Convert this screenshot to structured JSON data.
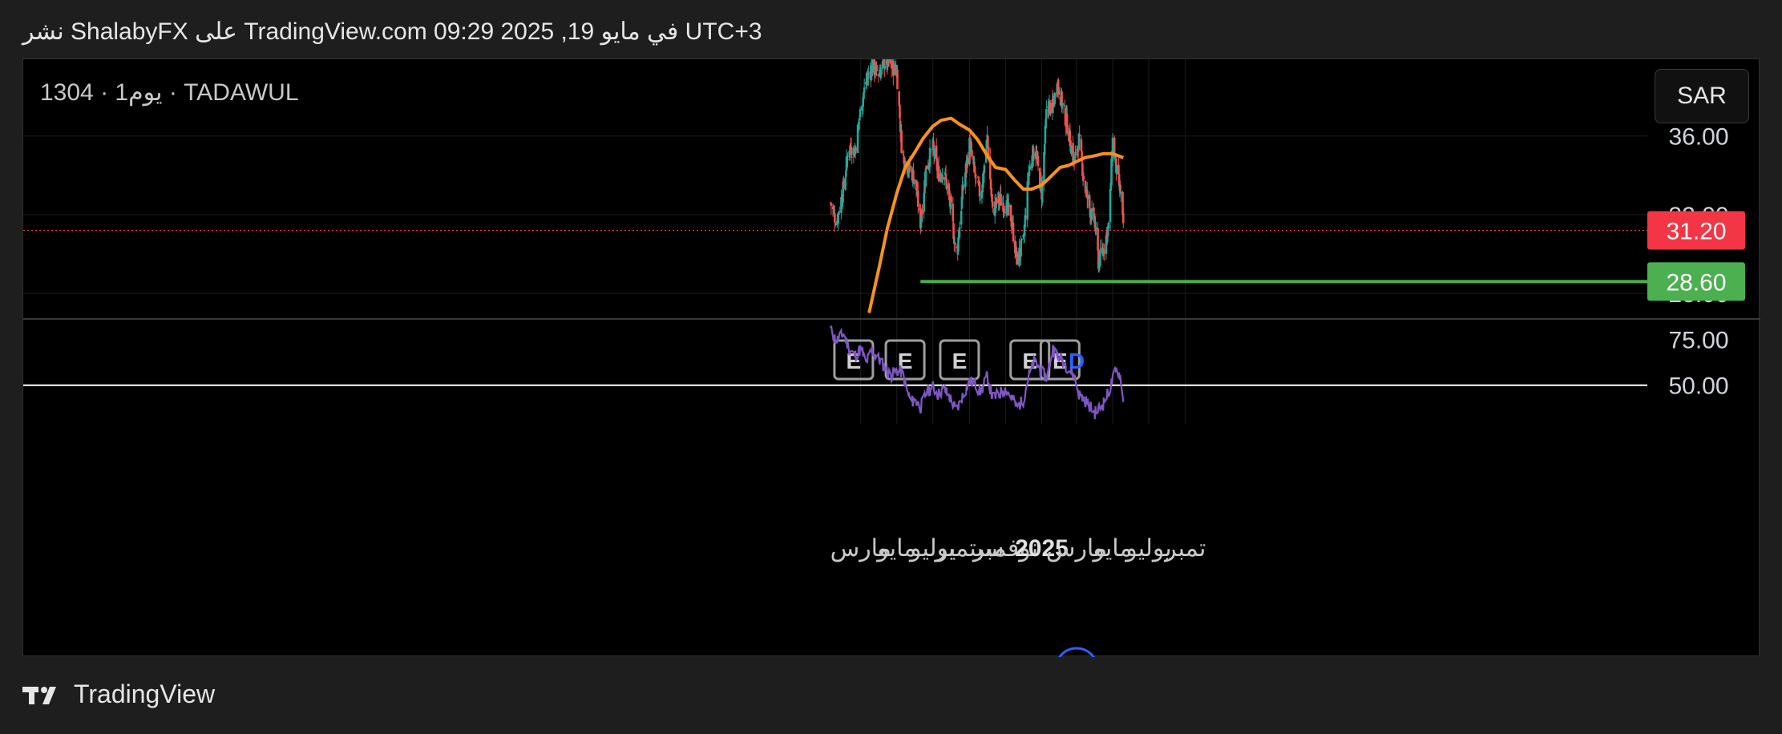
{
  "header": {
    "text": "نشر ShalabyFX على TradingView.com 09:29 2025 ,19 في مايو UTC+3"
  },
  "symbol": {
    "label": "1304 · 1يوم · TADAWUL"
  },
  "currency": {
    "label": "SAR"
  },
  "footer": {
    "brand": "TradingView",
    "logo_icon": "tradingview-logo-icon"
  },
  "colors": {
    "up": "#26a69a",
    "down": "#ef5350",
    "ma": "#f7931a",
    "support": "#4caf50",
    "rsi": "#7e57c2",
    "price_badge": "#f23645",
    "support_badge": "#4caf50"
  },
  "chart_data": [
    {
      "type": "candlestick",
      "title": "",
      "ylim": [
        26.7,
        39.9
      ],
      "y_ticks": [
        "36.00",
        "32.00",
        "28.00"
      ],
      "x_tick_labels": [
        "مارس",
        "مايو",
        "يوليو",
        "سبتمبر",
        "نوفمبر",
        "2025",
        "مارس",
        "مايو",
        "يوليو",
        "تمبر"
      ],
      "x_tick_dates": [
        "2024-03-01",
        "2024-05-01",
        "2024-07-01",
        "2024-09-01",
        "2024-11-01",
        "2025-01-01",
        "2025-03-01",
        "2025-05-01",
        "2025-07-01",
        "2025-09-01"
      ],
      "close_series": {
        "dates": [
          "2024-01-10",
          "2024-01-20",
          "2024-02-01",
          "2024-02-10",
          "2024-02-20",
          "2024-03-01",
          "2024-03-10",
          "2024-03-20",
          "2024-04-01",
          "2024-04-10",
          "2024-04-20",
          "2024-05-01",
          "2024-05-10",
          "2024-05-20",
          "2024-05-25",
          "2024-06-01",
          "2024-06-10",
          "2024-06-20",
          "2024-07-01",
          "2024-07-10",
          "2024-07-20",
          "2024-08-01",
          "2024-08-10",
          "2024-08-20",
          "2024-09-01",
          "2024-09-10",
          "2024-09-20",
          "2024-10-01",
          "2024-10-10",
          "2024-10-20",
          "2024-11-01",
          "2024-11-10",
          "2024-11-20",
          "2024-12-01",
          "2024-12-10",
          "2024-12-20",
          "2025-01-01",
          "2025-01-10",
          "2025-01-20",
          "2025-01-27",
          "2025-02-05",
          "2025-02-15",
          "2025-02-25",
          "2025-03-05",
          "2025-03-15",
          "2025-03-25",
          "2025-04-01",
          "2025-04-07",
          "2025-04-15",
          "2025-04-25",
          "2025-05-01",
          "2025-05-08",
          "2025-05-15",
          "2025-05-19"
        ],
        "close": [
          32.6,
          31.6,
          33.4,
          35.5,
          35.2,
          37.4,
          38.8,
          39.5,
          39.2,
          39.8,
          39.6,
          39.3,
          35.1,
          34.4,
          34.2,
          33.8,
          31.6,
          34.5,
          35.4,
          34.1,
          34.2,
          32.2,
          29.8,
          33.1,
          35.6,
          34.0,
          32.9,
          35.9,
          32.1,
          32.8,
          32.5,
          31.9,
          29.7,
          30.6,
          34.1,
          35.5,
          33.1,
          37.6,
          37.4,
          38.8,
          37.6,
          36.3,
          34.6,
          35.8,
          33.4,
          32.1,
          31.6,
          29.6,
          30.2,
          31.6,
          35.8,
          34.1,
          33.0,
          31.2
        ]
      },
      "moving_average": {
        "dates": [
          "2024-03-15",
          "2024-04-01",
          "2024-04-15",
          "2024-05-01",
          "2024-05-15",
          "2024-06-01",
          "2024-06-15",
          "2024-07-01",
          "2024-07-15",
          "2024-08-01",
          "2024-08-15",
          "2024-09-01",
          "2024-09-15",
          "2024-10-01",
          "2024-10-15",
          "2024-11-01",
          "2024-11-15",
          "2024-12-01",
          "2024-12-15",
          "2025-01-01",
          "2025-01-15",
          "2025-02-01",
          "2025-02-15",
          "2025-03-01",
          "2025-03-15",
          "2025-04-01",
          "2025-04-15",
          "2025-05-01",
          "2025-05-19"
        ],
        "values": [
          27.0,
          29.3,
          31.3,
          33.1,
          34.4,
          35.2,
          35.9,
          36.5,
          36.8,
          36.9,
          36.6,
          36.3,
          35.8,
          35.0,
          34.4,
          34.3,
          33.8,
          33.3,
          33.3,
          33.5,
          33.9,
          34.4,
          34.5,
          34.7,
          34.9,
          35.0,
          35.1,
          35.1,
          34.9
        ]
      },
      "last_price": {
        "value": 31.2,
        "label": "31.20"
      },
      "support_line": {
        "value": 28.6,
        "label": "28.60",
        "from_date": "2024-06-10"
      },
      "event_markers": [
        {
          "label": "E",
          "date": "2024-02-18"
        },
        {
          "label": "E",
          "date": "2024-05-15"
        },
        {
          "label": "E",
          "date": "2024-08-15"
        },
        {
          "label": "E",
          "date": "2024-12-12"
        },
        {
          "label": "E",
          "date": "2025-02-01"
        },
        {
          "label": "D",
          "date": "2025-03-01"
        }
      ]
    },
    {
      "type": "line",
      "title": "",
      "ylim": [
        29,
        86
      ],
      "y_ticks": [
        "75.00",
        "50.00"
      ],
      "reference_line": 50,
      "dates": [
        "2024-01-10",
        "2024-01-20",
        "2024-02-01",
        "2024-02-10",
        "2024-02-20",
        "2024-03-01",
        "2024-03-10",
        "2024-03-20",
        "2024-04-01",
        "2024-04-10",
        "2024-04-20",
        "2024-05-01",
        "2024-05-10",
        "2024-05-20",
        "2024-05-25",
        "2024-06-01",
        "2024-06-10",
        "2024-06-20",
        "2024-07-01",
        "2024-07-10",
        "2024-07-20",
        "2024-08-01",
        "2024-08-10",
        "2024-08-20",
        "2024-09-01",
        "2024-09-10",
        "2024-09-20",
        "2024-10-01",
        "2024-10-10",
        "2024-10-20",
        "2024-11-01",
        "2024-11-10",
        "2024-11-20",
        "2024-12-01",
        "2024-12-10",
        "2024-12-20",
        "2025-01-01",
        "2025-01-10",
        "2025-01-20",
        "2025-01-27",
        "2025-02-05",
        "2025-02-15",
        "2025-02-25",
        "2025-03-05",
        "2025-03-15",
        "2025-03-25",
        "2025-04-01",
        "2025-04-07",
        "2025-04-15",
        "2025-04-25",
        "2025-05-01",
        "2025-05-08",
        "2025-05-15",
        "2025-05-19"
      ],
      "values": [
        80,
        74,
        78,
        70,
        66,
        70,
        62,
        69,
        64,
        60,
        55,
        58,
        57,
        45,
        41,
        42,
        38,
        46,
        49,
        45,
        48,
        42,
        36,
        44,
        52,
        51,
        46,
        55,
        43,
        45,
        48,
        44,
        38,
        42,
        55,
        63,
        57,
        54,
        70,
        66,
        64,
        59,
        55,
        45,
        42,
        38,
        35,
        37,
        40,
        47,
        53,
        59,
        54,
        40
      ]
    }
  ]
}
